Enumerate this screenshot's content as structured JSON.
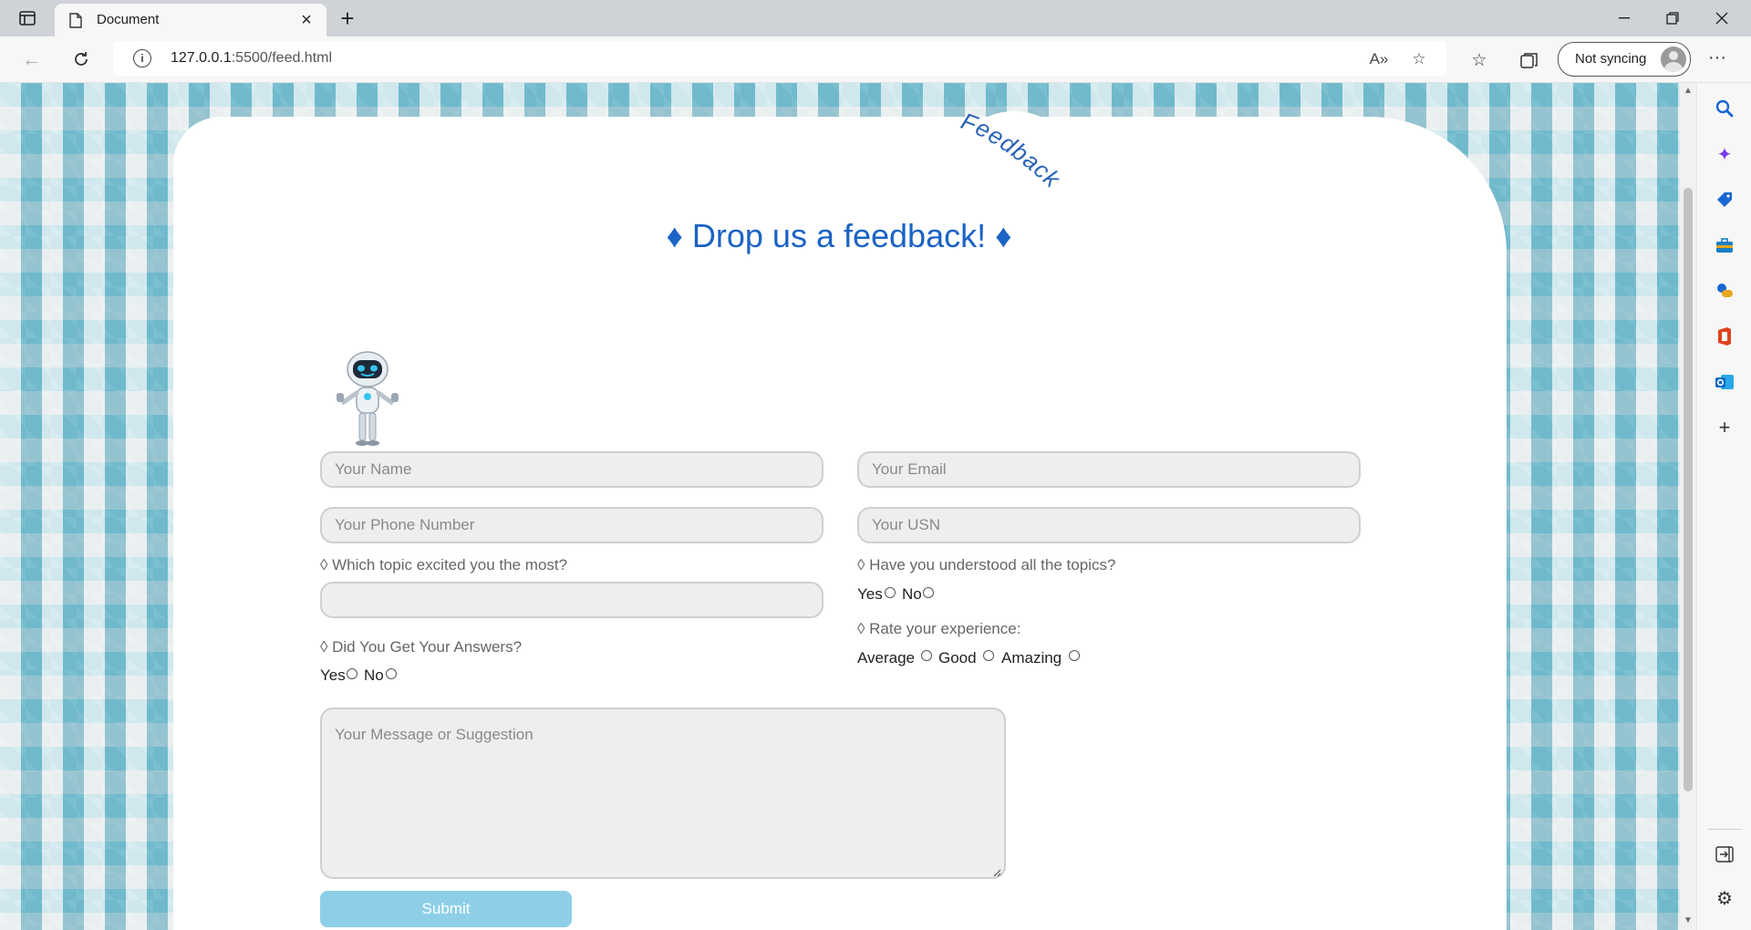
{
  "browser": {
    "tab_title": "Document",
    "url_host": "127.0.0.1",
    "url_path": ":5500/feed.html",
    "profile_label": "Not syncing"
  },
  "page": {
    "badge_text": "Feedback",
    "headline": "♦ Drop us a feedback! ♦",
    "name_placeholder": "Your Name",
    "email_placeholder": "Your Email",
    "phone_placeholder": "Your Phone Number",
    "usn_placeholder": "Your USN",
    "topic_question": "◊ Which topic excited you the most?",
    "topic_value": "",
    "understood_question": "◊ Have you understood all the topics?",
    "understood_options": [
      "Yes",
      "No"
    ],
    "rate_question": "◊ Rate your experience:",
    "rate_options": [
      "Average",
      "Good",
      "Amazing"
    ],
    "answers_question": "◊ Did You Get Your Answers?",
    "answers_options": [
      "Yes",
      "No"
    ],
    "message_placeholder": "Your Message or Suggestion",
    "submit_label": "Submit"
  },
  "colors": {
    "headline": "#1b63c4",
    "submit_bg": "#8ecfe8",
    "badge_text": "#2a63b8"
  }
}
